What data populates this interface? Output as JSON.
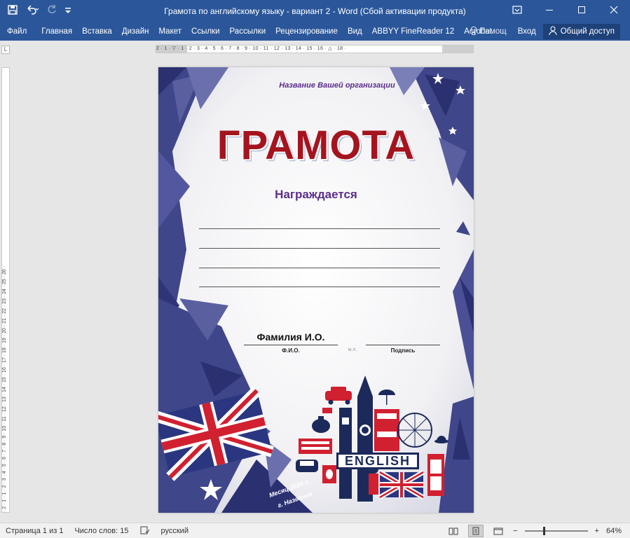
{
  "window": {
    "title": "Грамота по английскому языку - вариант 2 - Word (Сбой активации продукта)",
    "qat_icons": [
      "save-icon",
      "undo-icon",
      "redo-icon",
      "customize-icon"
    ],
    "controls": [
      "ribbon-display-icon",
      "minimize-icon",
      "maximize-icon",
      "close-icon"
    ]
  },
  "ribbon": {
    "tabs": [
      "Файл",
      "Главная",
      "Вставка",
      "Дизайн",
      "Макет",
      "Ссылки",
      "Рассылки",
      "Рецензирование",
      "Вид",
      "ABBYY FineReader 12",
      "Acrobat"
    ],
    "help_label": "Помощ",
    "login_label": "Вход",
    "share_label": "Общий доступ"
  },
  "ruler": {
    "horizontal": "2 · 1 · ▽ · 1 · 2 · 3 · 4 · 5 · 6 · 7 · 8 · 9 · 10 · 11 · 12 · 13 · 14 · 15 · 16 · △ · 18 ·",
    "vertical": "· 2 · 1 · 1 · 2 · 3 · 4 · 5 · 6 · 7 · 8 · 9 · 10 · 11 · 12 · 13 · 14 · 15 · 16 · 17 · 18 · 19 · 20 · 21 · 22 · 23 · 24 · 25 · 26 ·"
  },
  "document": {
    "organization": "Название Вашей организации",
    "title": "ГРАМОТА",
    "awarded": "Награждается",
    "name": "Фамилия И.О.",
    "caption_fio": "Ф.И.О.",
    "caption_mp": "м.п.",
    "caption_signature": "Подпись",
    "month": "Месяц 2020 г.",
    "city": "г. Название",
    "badge": "ENGLISH"
  },
  "statusbar": {
    "page": "Страница 1 из 1",
    "words": "Число слов: 15",
    "language": "русский",
    "zoom": "64%",
    "zoom_value": 0.64
  },
  "colors": {
    "titlebar": "#2b579a",
    "frame_navy": "#3f4689",
    "title_red": "#a5141e",
    "accent_purple": "#5a2d8a"
  }
}
